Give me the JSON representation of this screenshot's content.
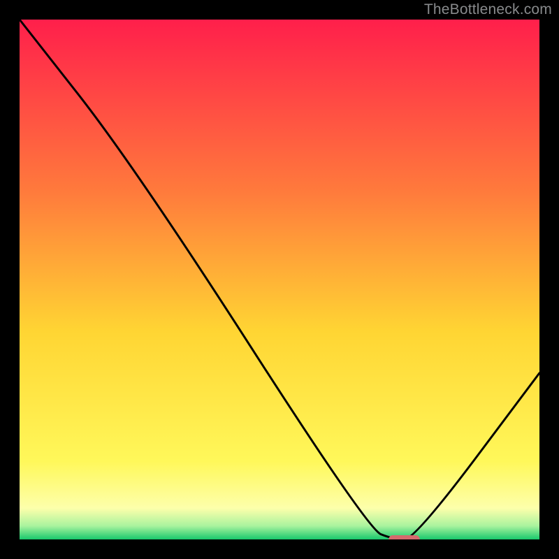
{
  "watermark": "TheBottleneck.com",
  "chart_data": {
    "type": "line",
    "title": "",
    "xlabel": "",
    "ylabel": "",
    "xlim": [
      0,
      100
    ],
    "ylim": [
      0,
      100
    ],
    "grid": false,
    "legend": false,
    "annotations": [],
    "series": [
      {
        "name": "curve",
        "x": [
          0,
          22,
          67,
          72,
          76,
          100
        ],
        "y": [
          100,
          72,
          2,
          0,
          0,
          32
        ]
      }
    ],
    "marker": {
      "x_center": 74,
      "y_center": 0,
      "width_pct": 6,
      "height_pct": 1.6,
      "color": "#d56a6d"
    },
    "background_gradient": {
      "stops": [
        {
          "y": 100,
          "color": "#ff1f4b"
        },
        {
          "y": 67,
          "color": "#ff7a3c"
        },
        {
          "y": 40,
          "color": "#ffd533"
        },
        {
          "y": 15,
          "color": "#fff85a"
        },
        {
          "y": 6,
          "color": "#fdffab"
        },
        {
          "y": 2.6,
          "color": "#a9f39e"
        },
        {
          "y": 0,
          "color": "#18c86c"
        }
      ]
    }
  }
}
